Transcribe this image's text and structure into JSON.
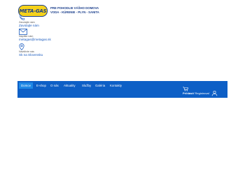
{
  "brand": {
    "logo_text": "META-GAS"
  },
  "tagline": {
    "line1": "PRE POHODLIE VÁŠHO DOMOVA",
    "line2": "VODA - KÚRENIE - PLYN - SANITA"
  },
  "contacts": [
    {
      "icon": "phone-icon",
      "label": "Zavolajte nám",
      "value": "Zavolajte nám"
    },
    {
      "icon": "mail-icon",
      "label": "Napíšte nám",
      "value": "metagas@metagas.sk"
    },
    {
      "icon": "location-icon",
      "label": "Navštívte nás",
      "value": "Sk na Slovensku"
    }
  ],
  "nav": {
    "items": [
      "Domov",
      "E-shop",
      "O nás",
      "Aktuality",
      "Služby",
      "Galéria",
      "Kontakty"
    ],
    "active_index": 0
  },
  "account": {
    "login_label": "Prihlásiť",
    "register_label": "Registrovať"
  },
  "colors": {
    "nav_bg": "#0d5fc6",
    "nav_active": "#1e88e5",
    "brand_blue": "#1a3e8c",
    "logo_yellow": "#f6d21a"
  }
}
